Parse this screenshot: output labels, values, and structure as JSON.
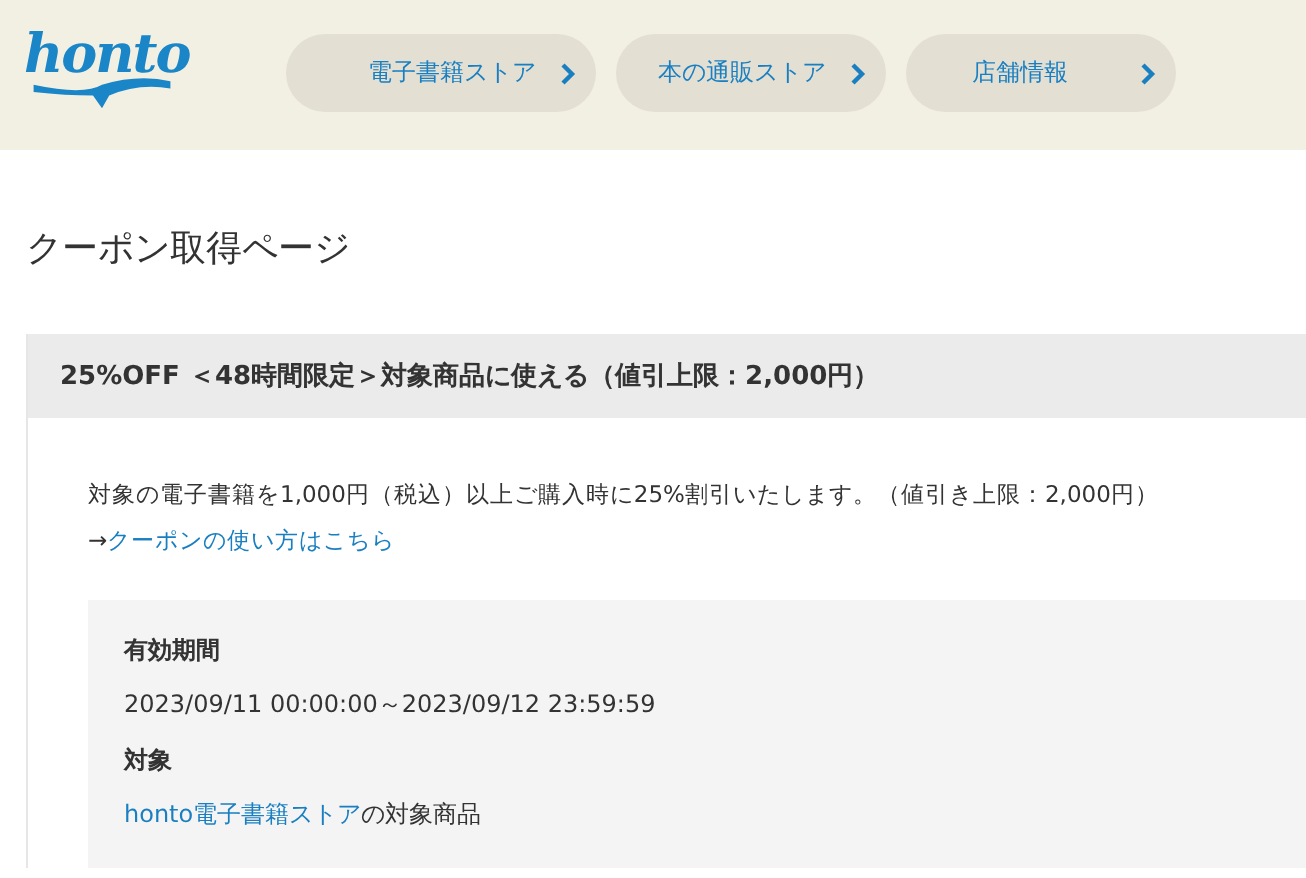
{
  "header": {
    "logo": "honto",
    "nav": [
      {
        "label": "電子書籍ストア"
      },
      {
        "label": "本の通販ストア"
      },
      {
        "label": "店舗情報"
      }
    ]
  },
  "page_title": "クーポン取得ページ",
  "coupon": {
    "title": "25%OFF ＜48時間限定＞対象商品に使える（値引上限：2,000円）",
    "description": "対象の電子書籍を1,000円（税込）以上ご購入時に25%割引いたします。（値引き上限：2,000円）",
    "how_to": {
      "arrow": "→",
      "link": "クーポンの使い方はこちら"
    },
    "details": [
      {
        "label": "有効期間",
        "value": "2023/09/11 00:00:00～2023/09/12 23:59:59"
      },
      {
        "label": "対象",
        "link": "honto電子書籍ストア",
        "value": "の対象商品"
      }
    ]
  }
}
